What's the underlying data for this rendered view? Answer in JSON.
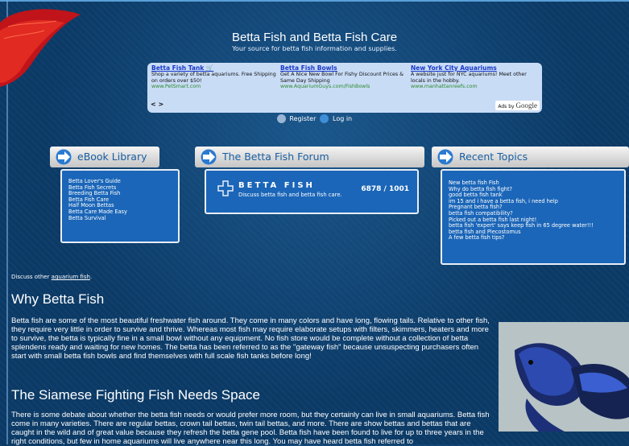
{
  "header": {
    "title": "Betta Fish and Betta Fish Care",
    "subtitle": "Your source for betta fish information and supplies."
  },
  "ads": {
    "items": [
      {
        "title": "Betta Fish Tank",
        "text": "Shop a variety of betta aquariums. Free Shipping on orders over $50!",
        "url": "www.PetSmart.com"
      },
      {
        "title": "Betta Fish Bowls",
        "text": "Get A Nice New Bowl For Fishy Discount Prices & Same Day Shipping",
        "url": "www.AquariumGuys.com/FishBowls"
      },
      {
        "title": "New York City Aquariums",
        "text": "A website just for NYC aquariums! Meet other locals in the hobby.",
        "url": "www.manhattanreefs.com"
      }
    ],
    "nav": "< >",
    "ads_by": "Ads by",
    "ads_brand": "Google"
  },
  "auth": {
    "register": "Register",
    "login": "Log in"
  },
  "ebook": {
    "title": "eBook Library",
    "items": [
      "Betta Lover's Guide",
      "Betta Fish Secrets",
      "Breeding Betta Fish",
      "Betta Fish Care",
      "Half Moon Bettas",
      "Betta Care Made Easy",
      "Betta Survival"
    ]
  },
  "forum": {
    "title": "The Betta Fish Forum",
    "name": "BETTA FISH",
    "description": "Discuss betta fish and betta fish care.",
    "count": "6878 / 1001"
  },
  "recent": {
    "title": "Recent Topics",
    "items": [
      "New betta fish Fish",
      "Why do betta fish fight?",
      "good betta fish tank",
      "im 15 and i have a betta fish, i need help",
      "Pregnant betta fish?",
      "betta fish compatibility?",
      "Picked out a betta fish last night!",
      "betta fish 'expert' says keep fish in 65 degree water!!!",
      "betta fish and Plecostomus",
      "A few betta fish tips?"
    ]
  },
  "note": {
    "prefix": "Discuss other",
    "link": "aquarium fish",
    "suffix": "."
  },
  "sections": [
    {
      "heading": "Why Betta Fish",
      "text": "Betta fish are some of the most beautiful freshwater fish around. They come in many colors and have long, flowing tails. Relative to other fish, they require very little in order to survive and thrive. Whereas most fish may require elaborate setups with filters, skimmers, heaters and more to survive, the betta is typically fine in a small bowl without any equipment. No fish store would be complete without a collection of betta splendens ready and waiting for new homes. The betta has been referred to as the \"gateway fish\" because unsuspecting purchasers often start with small betta fish bowls and find themselves with full scale fish tanks before long!"
    },
    {
      "heading": "The Siamese Fighting Fish Needs Space",
      "text": "There is some debate about whether the betta fish needs or would prefer more room, but they certainly can live in small aquariums. Betta fish come in many varieties. There are regular bettas, crown tail bettas, twin tail bettas, and more. There are show bettas and bettas that are caught in the wild and of great value because they refresh the betta gene pool. Betta fish have been found to live for up to three years in the right conditions, but few in home aquariums will live anywhere near this long. You may have heard betta fish referred to"
    }
  ],
  "colors": {
    "background": "#0b3a66",
    "panel": "#1b66b8",
    "accent": "#1a5fa0",
    "ad_bg": "#c9dcf6"
  }
}
